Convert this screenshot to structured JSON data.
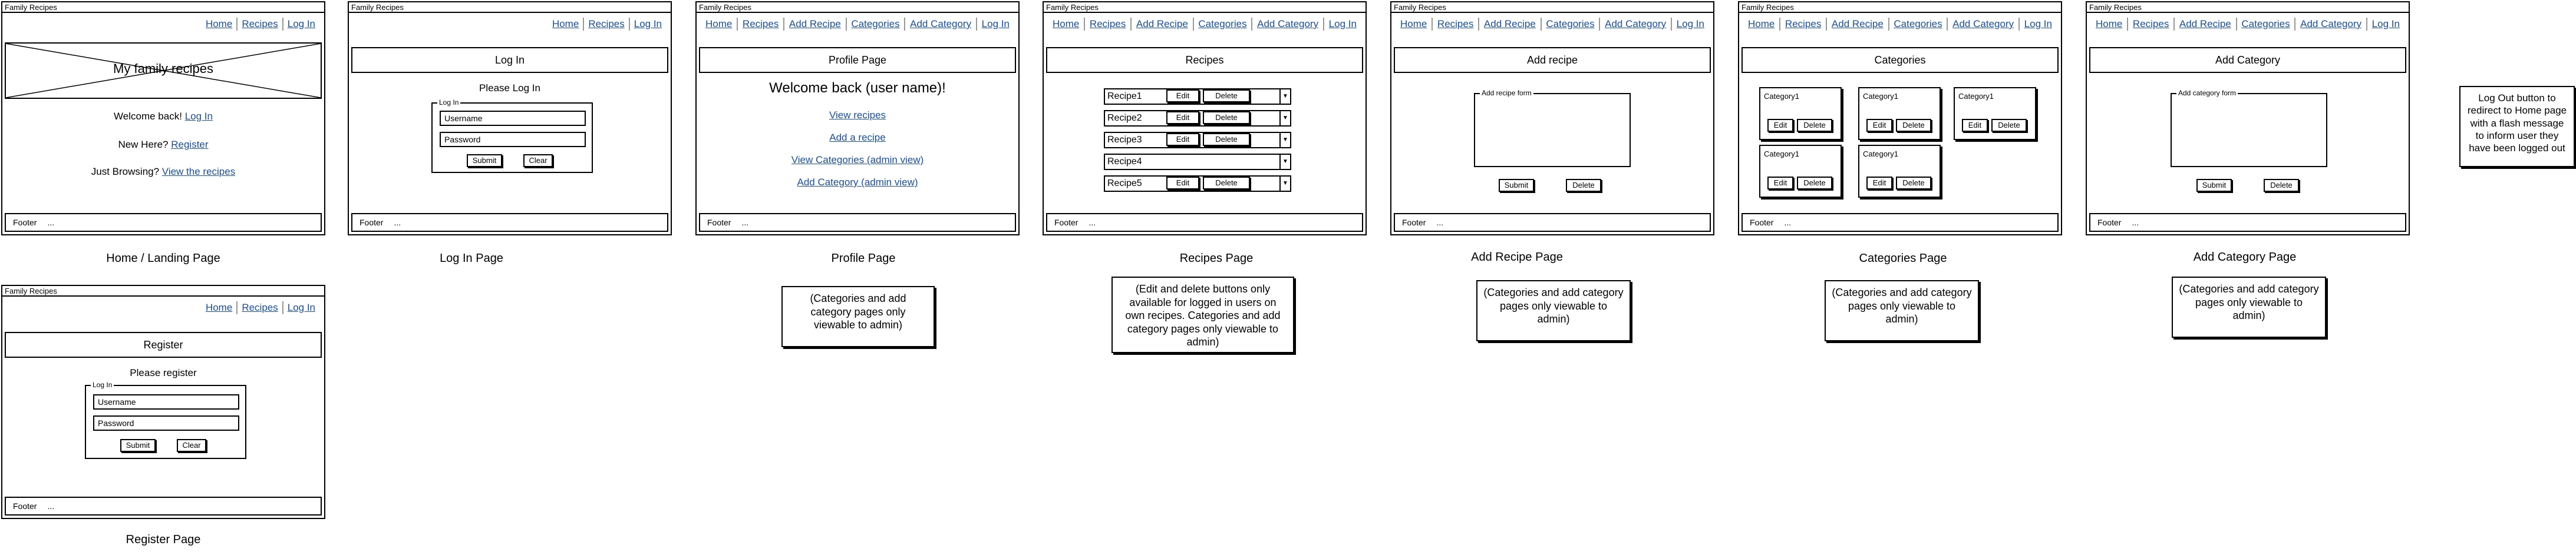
{
  "app_title": "Family Recipes",
  "nav_short": [
    "Home",
    "Recipes",
    "Log In"
  ],
  "nav_full": [
    "Home",
    "Recipes",
    "Add Recipe",
    "Categories",
    "Add Category",
    "Log In"
  ],
  "footer": {
    "label": "Footer",
    "dots": "..."
  },
  "home": {
    "banner": "My family recipes",
    "welcome_text": "Welcome back!",
    "welcome_link": "Log In",
    "new_text": "New Here?",
    "new_link": "Register",
    "browse_text": "Just Browsing?",
    "browse_link": "View the recipes",
    "caption": "Home / Landing Page"
  },
  "login": {
    "header": "Log In",
    "prompt": "Please Log In",
    "legend": "Log In",
    "username": "Username",
    "password": "Password",
    "submit": "Submit",
    "clear": "Clear",
    "caption": "Log In Page"
  },
  "register": {
    "header": "Register",
    "prompt": "Please register",
    "legend": "Log In",
    "username": "Username",
    "password": "Password",
    "submit": "Submit",
    "clear": "Clear",
    "caption": "Register Page"
  },
  "profile": {
    "header": "Profile Page",
    "welcome": "Welcome back (user name)!",
    "links": [
      "View recipes",
      "Add a recipe",
      "View Categories (admin view)",
      "Add Category (admin view)"
    ],
    "caption": "Profile Page",
    "note": "(Categories and add category pages only viewable to admin)"
  },
  "recipes": {
    "header": "Recipes",
    "rows": [
      {
        "name": "Recipe1",
        "buttons": true
      },
      {
        "name": "Recipe2",
        "buttons": true
      },
      {
        "name": "Recipe3",
        "buttons": true
      },
      {
        "name": "Recipe4",
        "buttons": false
      },
      {
        "name": "Recipe5",
        "buttons": true
      }
    ],
    "edit": "Edit",
    "delete": "Delete",
    "caption": "Recipes Page",
    "note": "(Edit and delete buttons only available for logged in users on own recipes. Categories and add category pages only viewable to admin)"
  },
  "add_recipe": {
    "header": "Add recipe",
    "legend": "Add recipe form",
    "submit": "Submit",
    "delete": "Delete",
    "caption": "Add Recipe Page",
    "note": "(Categories and add category pages only viewable to admin)"
  },
  "categories": {
    "header": "Categories",
    "cards": [
      "Category1",
      "Category1",
      "Category1",
      "Category1",
      "Category1"
    ],
    "edit": "Edit",
    "delete": "Delete",
    "caption": "Categories Page",
    "note": "(Categories and add category pages only viewable to admin)"
  },
  "add_category": {
    "header": "Add Category",
    "legend": "Add category form",
    "submit": "Submit",
    "delete": "Delete",
    "caption": "Add Category Page",
    "note": "(Categories and add category pages only viewable to admin)"
  },
  "logout_note": "Log Out button to redirect to Home page with a flash message to inform user they have been logged out"
}
